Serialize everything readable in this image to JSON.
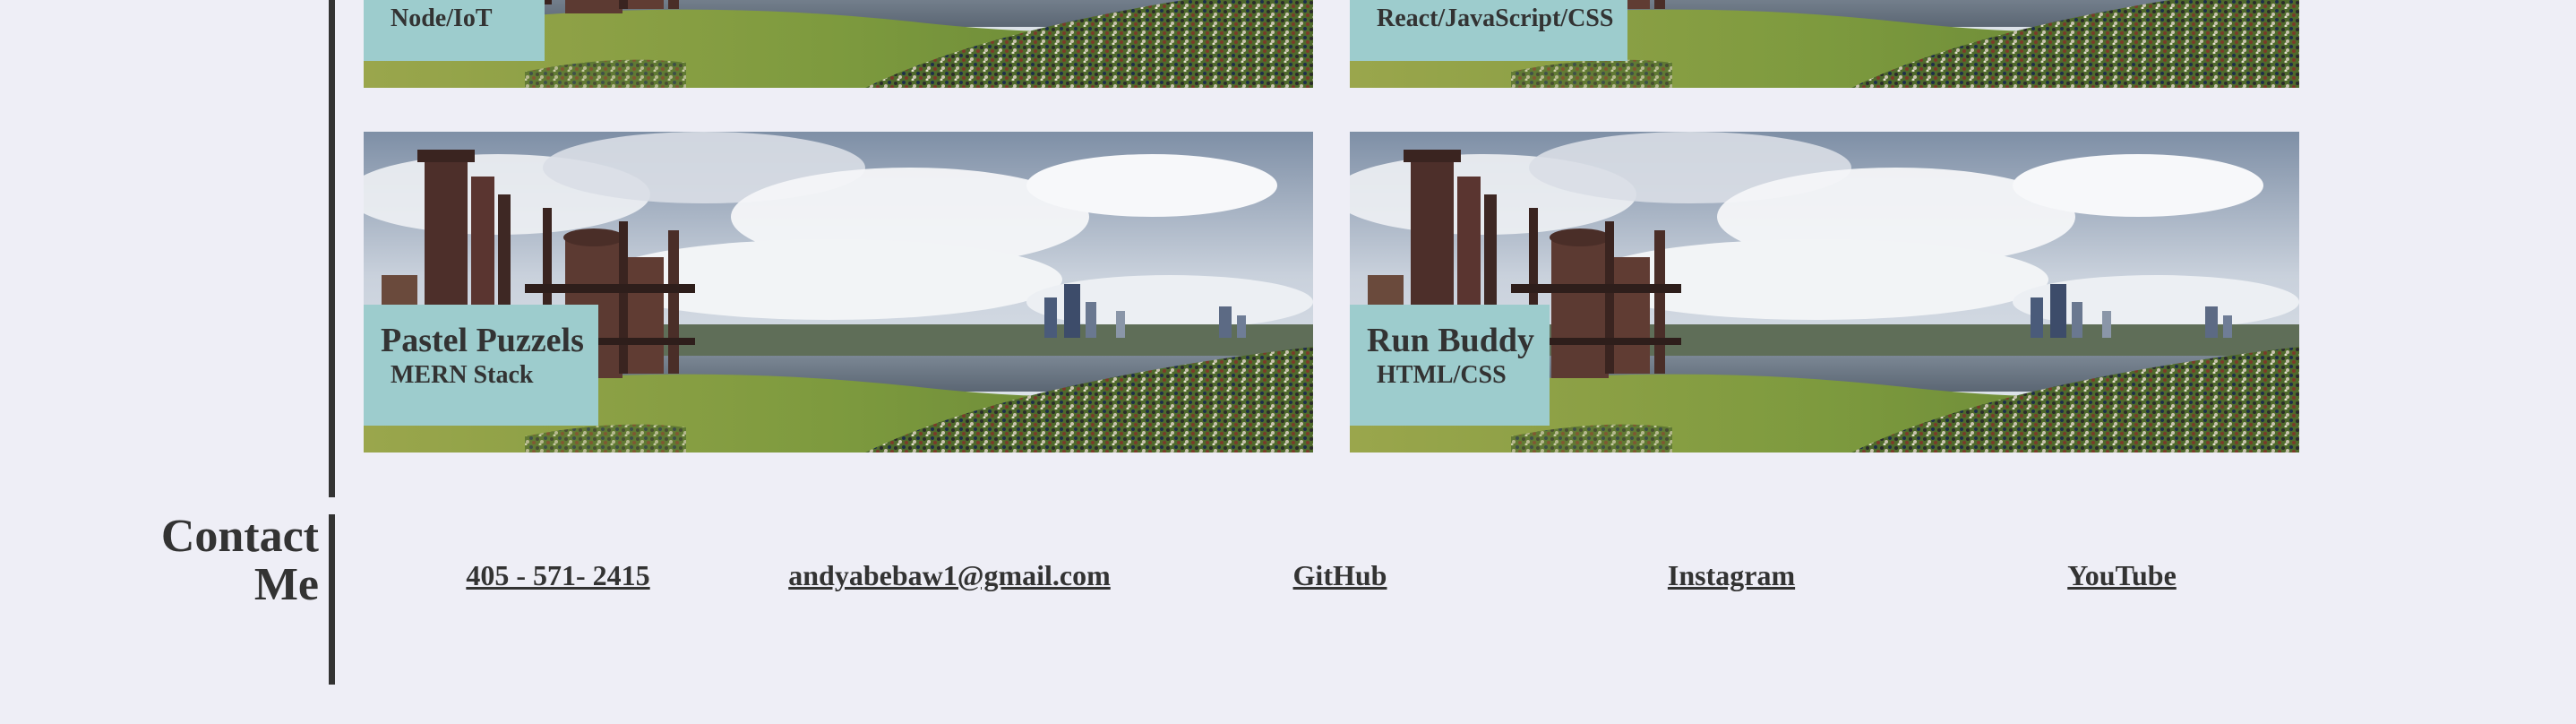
{
  "projects": [
    {
      "title": "",
      "stack": "Node/IoT"
    },
    {
      "title": "",
      "stack": "React/JavaScript/CSS"
    },
    {
      "title": "Pastel Puzzels",
      "stack": "MERN Stack"
    },
    {
      "title": "Run Buddy",
      "stack": "HTML/CSS"
    }
  ],
  "contact": {
    "heading_line1": "Contact",
    "heading_line2": "Me",
    "links": [
      {
        "label": "405 - 571- 2415"
      },
      {
        "label": "andyabebaw1@gmail.com"
      },
      {
        "label": "GitHub"
      },
      {
        "label": "Instagram"
      },
      {
        "label": "YouTube"
      }
    ]
  },
  "colors": {
    "background": "#eeeef6",
    "text": "#333333",
    "label_bg": "#9dcccd"
  }
}
